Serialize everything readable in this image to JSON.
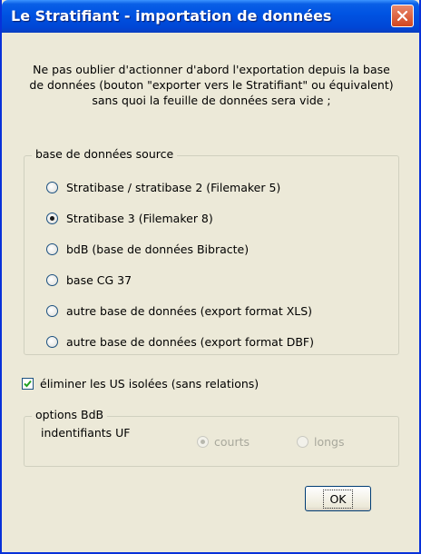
{
  "window": {
    "title": "Le Stratifiant - importation de données"
  },
  "intro": {
    "lines": [
      "Ne pas oublier d'actionner d'abord l'exportation depuis la base",
      "de données (bouton \"exporter vers le Stratifiant\" ou équivalent)",
      "sans quoi la feuille de données sera vide ;"
    ]
  },
  "source_group": {
    "legend": "base de données source",
    "options": [
      {
        "label": "Stratibase / stratibase 2 (Filemaker 5)",
        "checked": false
      },
      {
        "label": "Stratibase 3 (Filemaker 8)",
        "checked": true
      },
      {
        "label": "bdB (base de données Bibracte)",
        "checked": false
      },
      {
        "label": "base CG 37",
        "checked": false
      },
      {
        "label": "autre base de données (export format XLS)",
        "checked": false
      },
      {
        "label": "autre base de données (export format DBF)",
        "checked": false
      }
    ]
  },
  "eliminate_checkbox": {
    "label": "éliminer les US isolées (sans relations)",
    "checked": true
  },
  "bdb_options": {
    "legend": "options BdB",
    "field_label": "indentifiants UF",
    "choices": [
      {
        "label": "courts",
        "checked": true,
        "enabled": false
      },
      {
        "label": "longs",
        "checked": false,
        "enabled": false
      }
    ]
  },
  "buttons": {
    "ok": "OK"
  }
}
